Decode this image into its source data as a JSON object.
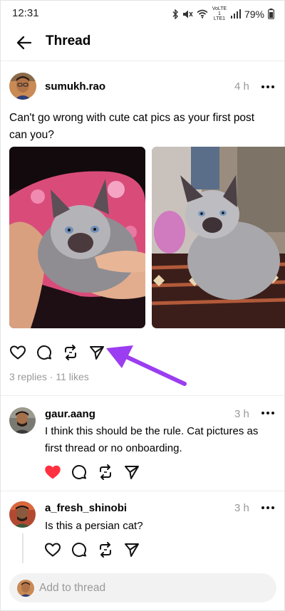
{
  "status_bar": {
    "time": "12:31",
    "network_label": "VoLTE1 LTE1",
    "battery": "79%"
  },
  "header": {
    "title": "Thread"
  },
  "post": {
    "username": "sumukh.rao",
    "time": "4 h",
    "text": "Can't go wrong with cute cat pics as your first post can you?",
    "meta": "3 replies · 11 likes",
    "photos": [
      "kitten held in hands on pink cushion",
      "grey kitten sitting on patterned rug"
    ]
  },
  "replies": [
    {
      "username": "gaur.aang",
      "time": "3 h",
      "text": "I think this should be the rule. Cat pictures as first thread or no onboarding.",
      "liked": true
    },
    {
      "username": "a_fresh_shinobi",
      "time": "3 h",
      "text": "Is this a persian cat?",
      "liked": false
    }
  ],
  "composer": {
    "placeholder": "Add to thread"
  },
  "colors": {
    "like_active": "#ff3040",
    "annotation_arrow": "#9b3df0",
    "meta_text": "#999999"
  }
}
